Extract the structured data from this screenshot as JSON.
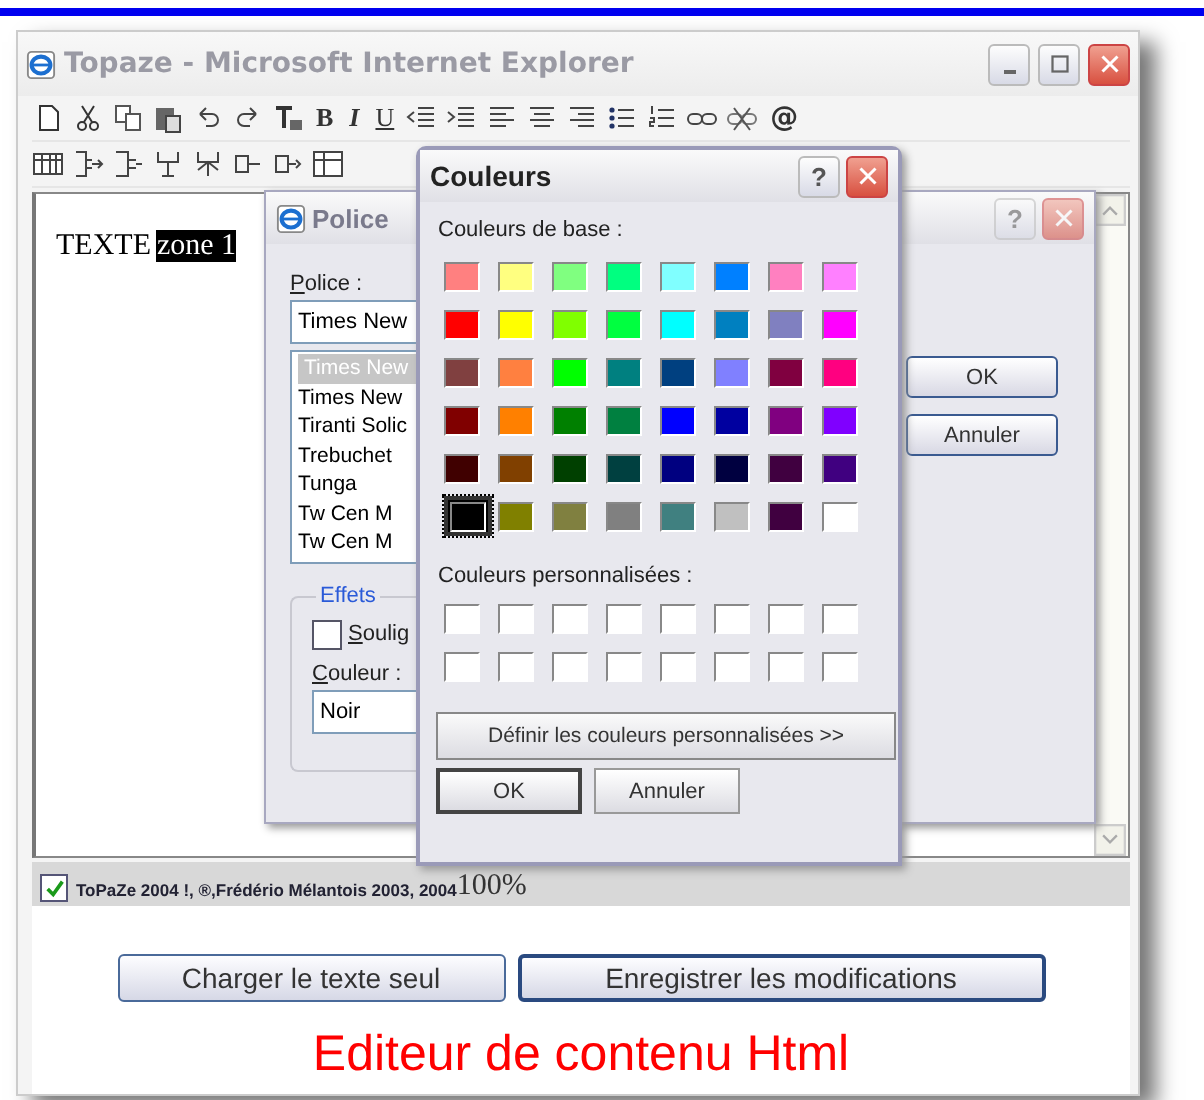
{
  "window": {
    "title": "Topaze - Microsoft Internet Explorer"
  },
  "toolbar": {
    "format_buttons": [
      "B",
      "I",
      "U"
    ],
    "at_button": "@"
  },
  "editor": {
    "text": "TEXTE",
    "selected_text": "zone 1"
  },
  "status_bar": {
    "checked": true,
    "text": "ToPaZe 2004 !, ®,Frédério Mélantois 2003, 2004",
    "zoom": "100%"
  },
  "buttons": [
    "Charger le texte seul",
    "Enregistrer les modifications"
  ],
  "heading": "Editeur de contenu Html",
  "font_dialog": {
    "title": "Police",
    "font_label": "Police :",
    "font_value": "Times New",
    "fonts": [
      {
        "name": "Times New",
        "selected": true
      },
      {
        "name": "Times New",
        "selected": false
      },
      {
        "name": "Tiranti Solic",
        "selected": false
      },
      {
        "name": "Trebuchet",
        "selected": false
      },
      {
        "name": "Tunga",
        "selected": false
      },
      {
        "name": "Tw Cen M",
        "selected": false
      },
      {
        "name": "Tw Cen M",
        "selected": false
      }
    ],
    "effects_label": "Effets",
    "underline_label": "Soulig",
    "underline_checked": false,
    "color_label": "Couleur :",
    "color_value": "Noir",
    "ok": "OK",
    "cancel": "Annuler"
  },
  "color_dialog": {
    "title": "Couleurs",
    "help": "?",
    "base_label": "Couleurs de base :",
    "swatches": [
      {
        "color": "#ff8080",
        "selected": false
      },
      {
        "color": "#ffff80",
        "selected": false
      },
      {
        "color": "#80ff80",
        "selected": false
      },
      {
        "color": "#00ff80",
        "selected": false
      },
      {
        "color": "#80ffff",
        "selected": false
      },
      {
        "color": "#0080ff",
        "selected": false
      },
      {
        "color": "#ff80c0",
        "selected": false
      },
      {
        "color": "#ff80ff",
        "selected": false
      },
      {
        "color": "#ff0000",
        "selected": false
      },
      {
        "color": "#ffff00",
        "selected": false
      },
      {
        "color": "#80ff00",
        "selected": false
      },
      {
        "color": "#00ff40",
        "selected": false
      },
      {
        "color": "#00ffff",
        "selected": false
      },
      {
        "color": "#0080c0",
        "selected": false
      },
      {
        "color": "#8080c0",
        "selected": false
      },
      {
        "color": "#ff00ff",
        "selected": false
      },
      {
        "color": "#804040",
        "selected": false
      },
      {
        "color": "#ff8040",
        "selected": false
      },
      {
        "color": "#00ff00",
        "selected": false
      },
      {
        "color": "#008080",
        "selected": false
      },
      {
        "color": "#004080",
        "selected": false
      },
      {
        "color": "#8080ff",
        "selected": false
      },
      {
        "color": "#800040",
        "selected": false
      },
      {
        "color": "#ff0080",
        "selected": false
      },
      {
        "color": "#800000",
        "selected": false
      },
      {
        "color": "#ff8000",
        "selected": false
      },
      {
        "color": "#008000",
        "selected": false
      },
      {
        "color": "#008040",
        "selected": false
      },
      {
        "color": "#0000ff",
        "selected": false
      },
      {
        "color": "#0000a0",
        "selected": false
      },
      {
        "color": "#800080",
        "selected": false
      },
      {
        "color": "#8000ff",
        "selected": false
      },
      {
        "color": "#400000",
        "selected": false
      },
      {
        "color": "#804000",
        "selected": false
      },
      {
        "color": "#004000",
        "selected": false
      },
      {
        "color": "#004040",
        "selected": false
      },
      {
        "color": "#000080",
        "selected": false
      },
      {
        "color": "#000040",
        "selected": false
      },
      {
        "color": "#400040",
        "selected": false
      },
      {
        "color": "#400080",
        "selected": false
      },
      {
        "color": "#000000",
        "selected": true
      },
      {
        "color": "#808000",
        "selected": false
      },
      {
        "color": "#808040",
        "selected": false
      },
      {
        "color": "#808080",
        "selected": false
      },
      {
        "color": "#408080",
        "selected": false
      },
      {
        "color": "#c0c0c0",
        "selected": false
      },
      {
        "color": "#400040",
        "selected": false
      },
      {
        "color": "#ffffff",
        "selected": false
      }
    ],
    "custom_label": "Couleurs personnalisées :",
    "define_button": "Définir les couleurs personnalisées >>",
    "ok": "OK",
    "cancel": "Annuler"
  }
}
